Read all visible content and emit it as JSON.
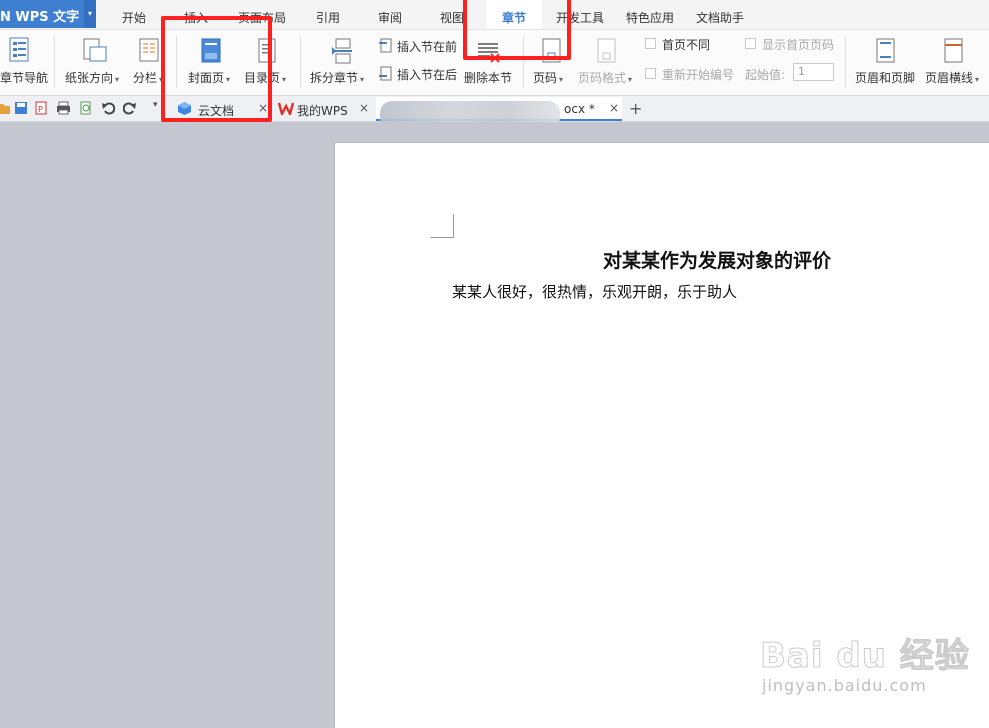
{
  "app": {
    "name": "N WPS 文字",
    "dropdown": "▾"
  },
  "menu": {
    "tabs": [
      {
        "label": "开始"
      },
      {
        "label": "插入"
      },
      {
        "label": "页面布局"
      },
      {
        "label": "引用"
      },
      {
        "label": "审阅"
      },
      {
        "label": "视图"
      },
      {
        "label": "章节",
        "active": true
      },
      {
        "label": "开发工具"
      },
      {
        "label": "特色应用"
      },
      {
        "label": "文档助手"
      }
    ]
  },
  "ribbon": {
    "chapter_nav": "章节导航",
    "paper_direction": "纸张方向",
    "columns": "分栏",
    "cover_page": "封面页",
    "toc_page": "目录页",
    "split_section": "拆分章节",
    "insert_section_before": "插入节在前",
    "insert_section_after": "插入节在后",
    "delete_section": "删除本节",
    "page_number": "页码",
    "page_number_format": "页码格式",
    "first_page_different": "首页不同",
    "show_first_page_number": "显示首页页码",
    "restart_numbering": "重新开始编号",
    "start_value_label": "起始值:",
    "start_value": "1",
    "header_footer": "页眉和页脚",
    "header_line": "页眉横线"
  },
  "doc_tabs": [
    {
      "label": "云文档"
    },
    {
      "label": "我的WPS"
    },
    {
      "label": "ocx *",
      "active": true
    }
  ],
  "document": {
    "title": "对某某作为发展对象的评价",
    "body": "某某人很好，很热情，乐观开朗，乐于助人"
  },
  "watermark": {
    "logo": "Bai du 经验",
    "url": "jingyan.baidu.com"
  },
  "colors": {
    "accent": "#3f7fd2",
    "highlight": "#ff2020",
    "workspace": "#c4c7cf"
  }
}
